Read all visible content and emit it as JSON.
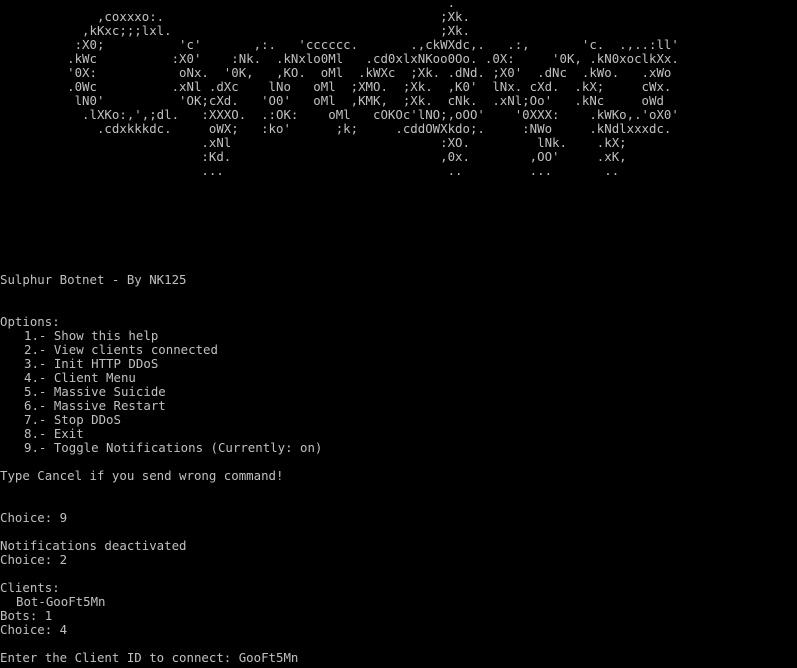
{
  "theme": {
    "background": "#000000",
    "foreground": "#c0c0c0"
  },
  "banner_art": "                                                            .\n             ,coxxxo:.                                     ;Xk.\n           ,kKxc;;;lxl.                                    ;Xk.\n          :X0;          'c'       ,:.   'cccccc.       .,ckWXdc,.   .:,       'c.  .,..:ll'\n         .kWc          :X0'    :Nk.  .kNxlo0Ml   .cd0xlxNKoo0Oo. .0X:     '0K, .kN0xoclkXx.\n         '0X:           oNx.  '0K,   ,KO.  oMl  .kWXc  ;Xk. .dNd. ;X0'  .dNc  .kWo.   .xWo\n         .0Wc          .xNl .dXc    lNo   oMl  ;XMO.  ;Xk.  ,K0'  lNx. cXd.  .kX;     cWx.\n          lN0'          'OK;cXd.   'O0'   oMl  ,KMK,  ;Xk.  cNk.  .xNl;Oo'   .kNc     oWd\n           .lXKo:,',;dl.   :XXXO.  .:OK:    oMl   cOKOc'lNO;,oOO'    '0XXX:    .kWKo,.'oX0'\n             .cdxkkkdc.     oWX;   :ko'      ;k;     .cddOWXkdo;.     :NWo     .kNdlxxxdc.\n                           .xNl                            :XO.         lNk.    .kX;\n                           :Kd.                            ,0x.        ,OO'     .xK,\n                           ...                              ..         ...       ..",
  "app_title": "Sulphur Botnet - By NK125",
  "options_header": "Options:",
  "options": [
    "1.- Show this help",
    "2.- View clients connected",
    "3.- Init HTTP DDoS",
    "4.- Client Menu",
    "5.- Massive Suicide",
    "6.- Massive Restart",
    "7.- Stop DDoS",
    "8.- Exit",
    "9.- Toggle Notifications (Currently: on)"
  ],
  "cancel_hint": "Type Cancel if you send wrong command!",
  "session": {
    "choice_1": "Choice: 9",
    "notifications_msg": "Notifications deactivated",
    "choice_2": "Choice: 2",
    "clients_header": "Clients:",
    "clients": [
      "Bot-GooFt5Mn"
    ],
    "bots_count": "Bots: 1",
    "choice_3": "Choice: 4",
    "client_id_prompt": "Enter the Client ID to connect: GooFt5Mn"
  }
}
